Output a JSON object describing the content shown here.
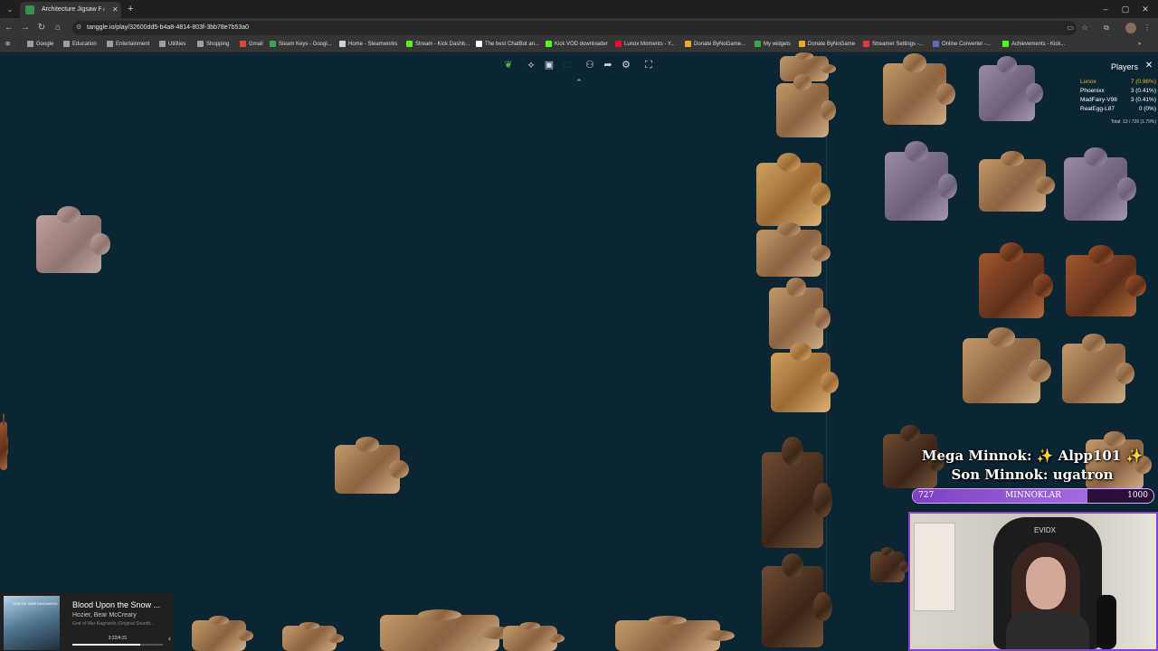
{
  "browser": {
    "tab_title": "Architecture Jigsaw Pu...",
    "url": "tanggle.io/play/32600dd5-b4a8-4814-803f-3bb78e7b53a0",
    "bookmarks": [
      {
        "label": "Google",
        "color": "#9aa0a6"
      },
      {
        "label": "Education",
        "color": "#9aa0a6"
      },
      {
        "label": "Entertainment",
        "color": "#9aa0a6"
      },
      {
        "label": "Utilities",
        "color": "#9aa0a6"
      },
      {
        "label": "Shopping",
        "color": "#9aa0a6"
      },
      {
        "label": "Gmail",
        "color": "#ea4335"
      },
      {
        "label": "Steam Keys - Googl...",
        "color": "#34a853"
      },
      {
        "label": "Home - Steamworks",
        "color": "#c7d5e0"
      },
      {
        "label": "Stream - Kick Dashb...",
        "color": "#53fc18"
      },
      {
        "label": "The best ChatBot an...",
        "color": "#ffffff"
      },
      {
        "label": "Kick VOD downloader",
        "color": "#53fc18"
      },
      {
        "label": "Lunox Moments - Y...",
        "color": "#ff0033"
      },
      {
        "label": "Donate ByNoGame...",
        "color": "#f5a623"
      },
      {
        "label": "My widgets",
        "color": "#34a853"
      },
      {
        "label": "Donate ByNoGame",
        "color": "#f5a623"
      },
      {
        "label": "Streamer Settings -...",
        "color": "#e53935"
      },
      {
        "label": "Online Converter -...",
        "color": "#5c6bc0"
      },
      {
        "label": "Achievements - Kick...",
        "color": "#53fc18"
      }
    ]
  },
  "puzzle": {
    "tools": [
      "leaf-icon",
      "puzzle-icon",
      "image-preview-icon",
      "box-icon",
      "players-icon",
      "share-icon",
      "settings-icon",
      "fullscreen-icon"
    ],
    "tool_glyphs": [
      "❦",
      "⟡",
      "▣",
      "□",
      "⚇",
      "➦",
      "⚙",
      "⛶"
    ],
    "players_panel": {
      "title": "Players",
      "players": [
        {
          "name": "Lunox",
          "score": "7 (0.96%)",
          "color": "#f0b429"
        },
        {
          "name": "Phoenixx",
          "score": "3 (0.41%)",
          "color": "#ffffff"
        },
        {
          "name": "MadFairy-V98",
          "score": "3 (0.41%)",
          "color": "#ffffff"
        },
        {
          "name": "RealEgg-L87",
          "score": "0 (0%)",
          "color": "#ffffff"
        }
      ],
      "total": "Total: 13 / 726 (1.79%)"
    }
  },
  "overlay": {
    "line1": "Mega Minnok: ✨ Alpp101 ✨",
    "line2": "Son Minnok: ugatron",
    "goal_label": "MINNOKLAR",
    "goal_current": "727",
    "goal_max": "1000",
    "goal_fraction": 0.727,
    "accent": "#8c3fd6",
    "chair_brand": "EVIDX"
  },
  "media": {
    "album_art_title": "GOD OF WAR RAGNARÖK",
    "title": "Blood Upon the Snow ...",
    "artist": "Hozier, Bear McCreary",
    "album": "God of War Ragnarök (Original Soundt...",
    "time": "3:22/4:31",
    "progress": 0.745
  }
}
